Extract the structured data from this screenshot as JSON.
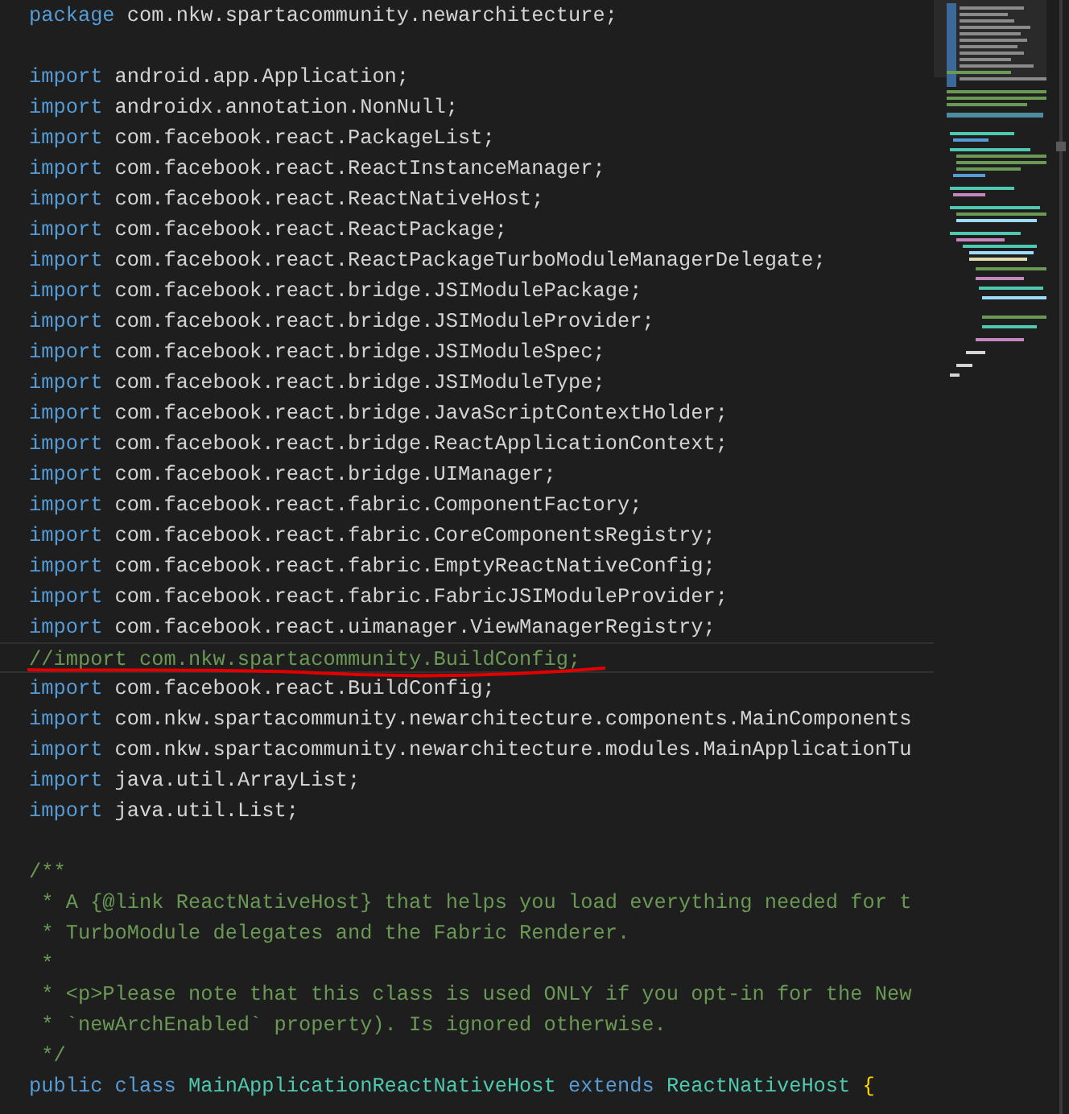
{
  "editor": {
    "lines": [
      {
        "highlighted": false,
        "underlined": false,
        "tokens": [
          {
            "kind": "keyword",
            "text": "package"
          },
          {
            "kind": "plain",
            "text": " com.nkw.spartacommunity.newarchitecture;"
          }
        ]
      },
      {
        "kind": "blank"
      },
      {
        "highlighted": false,
        "underlined": false,
        "tokens": [
          {
            "kind": "keyword",
            "text": "import"
          },
          {
            "kind": "plain",
            "text": " android.app.Application;"
          }
        ]
      },
      {
        "highlighted": false,
        "underlined": false,
        "tokens": [
          {
            "kind": "keyword",
            "text": "import"
          },
          {
            "kind": "plain",
            "text": " androidx.annotation.NonNull;"
          }
        ]
      },
      {
        "highlighted": false,
        "underlined": false,
        "tokens": [
          {
            "kind": "keyword",
            "text": "import"
          },
          {
            "kind": "plain",
            "text": " com.facebook.react.PackageList;"
          }
        ]
      },
      {
        "highlighted": false,
        "underlined": false,
        "tokens": [
          {
            "kind": "keyword",
            "text": "import"
          },
          {
            "kind": "plain",
            "text": " com.facebook.react.ReactInstanceManager;"
          }
        ]
      },
      {
        "highlighted": false,
        "underlined": false,
        "tokens": [
          {
            "kind": "keyword",
            "text": "import"
          },
          {
            "kind": "plain",
            "text": " com.facebook.react.ReactNativeHost;"
          }
        ]
      },
      {
        "highlighted": false,
        "underlined": false,
        "tokens": [
          {
            "kind": "keyword",
            "text": "import"
          },
          {
            "kind": "plain",
            "text": " com.facebook.react.ReactPackage;"
          }
        ]
      },
      {
        "highlighted": false,
        "underlined": false,
        "tokens": [
          {
            "kind": "keyword",
            "text": "import"
          },
          {
            "kind": "plain",
            "text": " com.facebook.react.ReactPackageTurboModuleManagerDelegate;"
          }
        ]
      },
      {
        "highlighted": false,
        "underlined": false,
        "tokens": [
          {
            "kind": "keyword",
            "text": "import"
          },
          {
            "kind": "plain",
            "text": " com.facebook.react.bridge.JSIModulePackage;"
          }
        ]
      },
      {
        "highlighted": false,
        "underlined": false,
        "tokens": [
          {
            "kind": "keyword",
            "text": "import"
          },
          {
            "kind": "plain",
            "text": " com.facebook.react.bridge.JSIModuleProvider;"
          }
        ]
      },
      {
        "highlighted": false,
        "underlined": false,
        "tokens": [
          {
            "kind": "keyword",
            "text": "import"
          },
          {
            "kind": "plain",
            "text": " com.facebook.react.bridge.JSIModuleSpec;"
          }
        ]
      },
      {
        "highlighted": false,
        "underlined": false,
        "tokens": [
          {
            "kind": "keyword",
            "text": "import"
          },
          {
            "kind": "plain",
            "text": " com.facebook.react.bridge.JSIModuleType;"
          }
        ]
      },
      {
        "highlighted": false,
        "underlined": false,
        "tokens": [
          {
            "kind": "keyword",
            "text": "import"
          },
          {
            "kind": "plain",
            "text": " com.facebook.react.bridge.JavaScriptContextHolder;"
          }
        ]
      },
      {
        "highlighted": false,
        "underlined": false,
        "tokens": [
          {
            "kind": "keyword",
            "text": "import"
          },
          {
            "kind": "plain",
            "text": " com.facebook.react.bridge.ReactApplicationContext;"
          }
        ]
      },
      {
        "highlighted": false,
        "underlined": false,
        "tokens": [
          {
            "kind": "keyword",
            "text": "import"
          },
          {
            "kind": "plain",
            "text": " com.facebook.react.bridge.UIManager;"
          }
        ]
      },
      {
        "highlighted": false,
        "underlined": false,
        "tokens": [
          {
            "kind": "keyword",
            "text": "import"
          },
          {
            "kind": "plain",
            "text": " com.facebook.react.fabric.ComponentFactory;"
          }
        ]
      },
      {
        "highlighted": false,
        "underlined": false,
        "tokens": [
          {
            "kind": "keyword",
            "text": "import"
          },
          {
            "kind": "plain",
            "text": " com.facebook.react.fabric.CoreComponentsRegistry;"
          }
        ]
      },
      {
        "highlighted": false,
        "underlined": false,
        "tokens": [
          {
            "kind": "keyword",
            "text": "import"
          },
          {
            "kind": "plain",
            "text": " com.facebook.react.fabric.EmptyReactNativeConfig;"
          }
        ]
      },
      {
        "highlighted": false,
        "underlined": false,
        "tokens": [
          {
            "kind": "keyword",
            "text": "import"
          },
          {
            "kind": "plain",
            "text": " com.facebook.react.fabric.FabricJSIModuleProvider;"
          }
        ]
      },
      {
        "highlighted": false,
        "underlined": false,
        "tokens": [
          {
            "kind": "keyword",
            "text": "import"
          },
          {
            "kind": "plain",
            "text": " com.facebook.react.uimanager.ViewManagerRegistry;"
          }
        ]
      },
      {
        "highlighted": true,
        "underlined": true,
        "tokens": [
          {
            "kind": "comment",
            "text": "//import com.nkw.spartacommunity.BuildConfig;"
          }
        ]
      },
      {
        "highlighted": false,
        "underlined": false,
        "tokens": [
          {
            "kind": "keyword",
            "text": "import"
          },
          {
            "kind": "plain",
            "text": " com.facebook.react.BuildConfig;"
          }
        ]
      },
      {
        "highlighted": false,
        "underlined": false,
        "tokens": [
          {
            "kind": "keyword",
            "text": "import"
          },
          {
            "kind": "plain",
            "text": " com.nkw.spartacommunity.newarchitecture.components.MainComponents"
          }
        ]
      },
      {
        "highlighted": false,
        "underlined": false,
        "tokens": [
          {
            "kind": "keyword",
            "text": "import"
          },
          {
            "kind": "plain",
            "text": " com.nkw.spartacommunity.newarchitecture.modules.MainApplicationTu"
          }
        ]
      },
      {
        "highlighted": false,
        "underlined": false,
        "tokens": [
          {
            "kind": "keyword",
            "text": "import"
          },
          {
            "kind": "plain",
            "text": " java.util.ArrayList;"
          }
        ]
      },
      {
        "highlighted": false,
        "underlined": false,
        "tokens": [
          {
            "kind": "keyword",
            "text": "import"
          },
          {
            "kind": "plain",
            "text": " java.util.List;"
          }
        ]
      },
      {
        "kind": "blank"
      },
      {
        "highlighted": false,
        "underlined": false,
        "tokens": [
          {
            "kind": "comment",
            "text": "/**"
          }
        ]
      },
      {
        "highlighted": false,
        "underlined": false,
        "tokens": [
          {
            "kind": "comment",
            "text": " * A {@link ReactNativeHost} that helps you load everything needed for t"
          }
        ]
      },
      {
        "highlighted": false,
        "underlined": false,
        "tokens": [
          {
            "kind": "comment",
            "text": " * TurboModule delegates and the Fabric Renderer."
          }
        ]
      },
      {
        "highlighted": false,
        "underlined": false,
        "tokens": [
          {
            "kind": "comment",
            "text": " *"
          }
        ]
      },
      {
        "highlighted": false,
        "underlined": false,
        "tokens": [
          {
            "kind": "comment",
            "text": " * <p>Please note that this class is used ONLY if you opt-in for the New"
          }
        ]
      },
      {
        "highlighted": false,
        "underlined": false,
        "tokens": [
          {
            "kind": "comment",
            "text": " * `newArchEnabled` property). Is ignored otherwise."
          }
        ]
      },
      {
        "highlighted": false,
        "underlined": false,
        "tokens": [
          {
            "kind": "comment",
            "text": " */"
          }
        ]
      },
      {
        "highlighted": false,
        "underlined": false,
        "tokens": [
          {
            "kind": "keyword",
            "text": "public class"
          },
          {
            "kind": "type",
            "text": " MainApplicationReactNativeHost"
          },
          {
            "kind": "keyword",
            "text": " extends"
          },
          {
            "kind": "type",
            "text": " ReactNativeHost"
          },
          {
            "kind": "brace",
            "text": " {"
          }
        ]
      }
    ]
  }
}
